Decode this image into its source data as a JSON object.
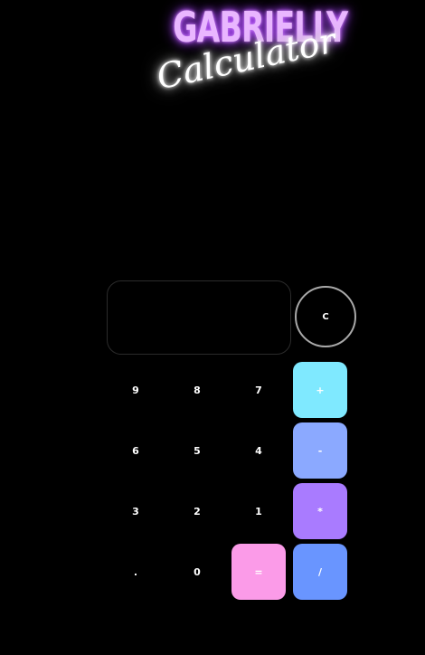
{
  "logo": {
    "title": "GABRIELLY",
    "subtitle": "Calculator"
  },
  "display": {
    "value": ""
  },
  "controls": {
    "clear": "C"
  },
  "keys": {
    "nine": "9",
    "eight": "8",
    "seven": "7",
    "six": "6",
    "five": "5",
    "four": "4",
    "three": "3",
    "two": "2",
    "one": "1",
    "dot": ".",
    "zero": "0",
    "equals": "=",
    "plus": "+",
    "minus": "-",
    "multiply": "*",
    "divide": "/"
  },
  "colors": {
    "background": "#000000",
    "equals": "#fb9be8",
    "plus": "#7fe9ff",
    "minus": "#8ba9ff",
    "multiply": "#a97bff",
    "divide": "#6995ff",
    "neon_purple": "#e9b6ff"
  }
}
